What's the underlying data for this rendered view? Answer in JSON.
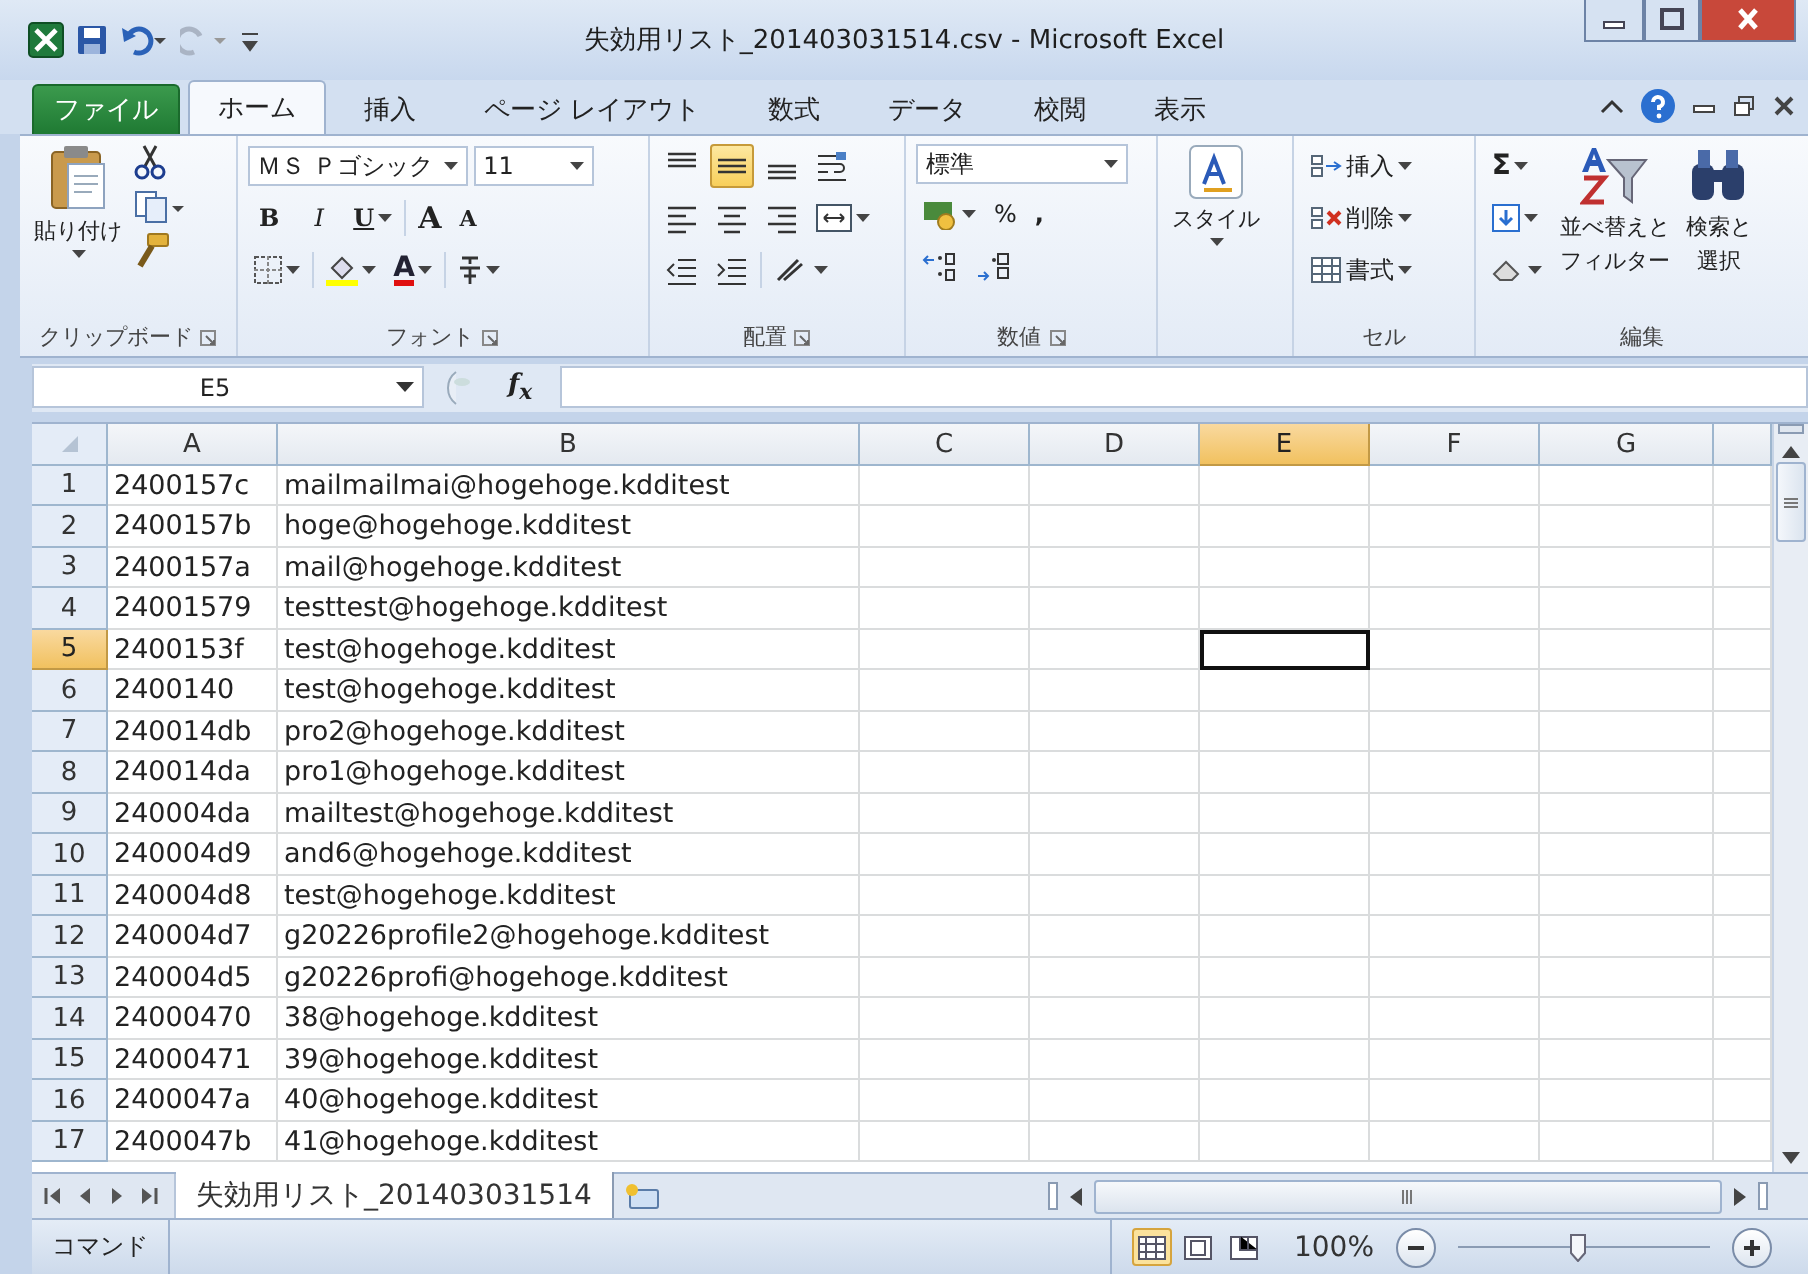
{
  "window": {
    "title": "失効用リスト_201403031514.csv - Microsoft Excel"
  },
  "ribbon_tabs": [
    {
      "label": "ファイル",
      "kind": "file",
      "selected": false
    },
    {
      "label": "ホーム",
      "kind": "tab",
      "selected": true
    },
    {
      "label": "挿入",
      "kind": "tab",
      "selected": false
    },
    {
      "label": "ページ レイアウト",
      "kind": "tab",
      "selected": false
    },
    {
      "label": "数式",
      "kind": "tab",
      "selected": false
    },
    {
      "label": "データ",
      "kind": "tab",
      "selected": false
    },
    {
      "label": "校閲",
      "kind": "tab",
      "selected": false
    },
    {
      "label": "表示",
      "kind": "tab",
      "selected": false
    }
  ],
  "clipboard": {
    "paste": "貼り付け",
    "label": "クリップボード"
  },
  "font": {
    "name": "ＭＳ Ｐゴシック",
    "size": "11",
    "bold": "B",
    "italic": "I",
    "underline": "U",
    "grow": "A",
    "shrink": "A",
    "color_letter": "A",
    "label": "フォント"
  },
  "alignment": {
    "vertical": [
      {
        "kind": "top",
        "selected": false
      },
      {
        "kind": "middle",
        "selected": true
      },
      {
        "kind": "bottom",
        "selected": false
      }
    ],
    "label": "配置"
  },
  "number": {
    "format": "標準",
    "percent": "%",
    "comma": ",",
    "label": "数値"
  },
  "styles": {
    "label": "スタイル"
  },
  "cells": {
    "items": [
      {
        "kind": "insert",
        "label": "挿入"
      },
      {
        "kind": "delete",
        "label": "削除"
      },
      {
        "kind": "format",
        "label": "書式"
      }
    ],
    "label": "セル"
  },
  "editing": {
    "sum": "Σ",
    "sort": [
      "並べ替えと",
      "フィルター"
    ],
    "find": [
      "検索と",
      "選択"
    ],
    "label": "編集"
  },
  "formula_bar": {
    "name_box": "E5",
    "function_label": "f$_{x}$"
  },
  "columns": [
    {
      "label": "A",
      "selected": false
    },
    {
      "label": "B",
      "selected": false
    },
    {
      "label": "C",
      "selected": false
    },
    {
      "label": "D",
      "selected": false
    },
    {
      "label": "E",
      "selected": true
    },
    {
      "label": "F",
      "selected": false
    },
    {
      "label": "G",
      "selected": false
    }
  ],
  "rows": [
    {
      "header": "1",
      "selected": false,
      "cells": [
        "2400157c",
        "mailmailmai@hogehoge.kdditest"
      ]
    },
    {
      "header": "2",
      "selected": false,
      "cells": [
        "2400157b",
        "hoge@hogehoge.kdditest"
      ]
    },
    {
      "header": "3",
      "selected": false,
      "cells": [
        "2400157a",
        "mail@hogehoge.kdditest"
      ]
    },
    {
      "header": "4",
      "selected": false,
      "cells": [
        "24001579",
        "testtest@hogehoge.kdditest"
      ]
    },
    {
      "header": "5",
      "selected": true,
      "cells": [
        "2400153f",
        "test@hogehoge.kdditest"
      ]
    },
    {
      "header": "6",
      "selected": false,
      "cells": [
        "2400140",
        "test@hogehoge.kdditest"
      ]
    },
    {
      "header": "7",
      "selected": false,
      "cells": [
        "240014db",
        "pro2@hogehoge.kdditest"
      ]
    },
    {
      "header": "8",
      "selected": false,
      "cells": [
        "240014da",
        "pro1@hogehoge.kdditest"
      ]
    },
    {
      "header": "9",
      "selected": false,
      "cells": [
        "240004da",
        "mailtest@hogehoge.kdditest"
      ]
    },
    {
      "header": "10",
      "selected": false,
      "cells": [
        "240004d9",
        "and6@hogehoge.kdditest"
      ]
    },
    {
      "header": "11",
      "selected": false,
      "cells": [
        "240004d8",
        "test@hogehoge.kdditest"
      ]
    },
    {
      "header": "12",
      "selected": false,
      "cells": [
        "240004d7",
        "g20226profile2@hogehoge.kdditest"
      ]
    },
    {
      "header": "13",
      "selected": false,
      "cells": [
        "240004d5",
        "g20226profi@hogehoge.kdditest"
      ]
    },
    {
      "header": "14",
      "selected": false,
      "cells": [
        "24000470",
        "38@hogehoge.kdditest"
      ]
    },
    {
      "header": "15",
      "selected": false,
      "cells": [
        "24000471",
        "39@hogehoge.kdditest"
      ]
    },
    {
      "header": "16",
      "selected": false,
      "cells": [
        "2400047a",
        "40@hogehoge.kdditest"
      ]
    },
    {
      "header": "17",
      "selected": false,
      "cells": [
        "2400047b",
        "41@hogehoge.kdditest"
      ]
    }
  ],
  "sheet_tabs": [
    {
      "label": "失効用リスト_201403031514",
      "selected": true
    }
  ],
  "status_bar": {
    "mode": "コマンド",
    "views": [
      {
        "kind": "normal",
        "selected": true
      },
      {
        "kind": "layout",
        "selected": false
      },
      {
        "kind": "pagebreak",
        "selected": false
      }
    ],
    "zoom": "100%",
    "level": 0.48
  }
}
